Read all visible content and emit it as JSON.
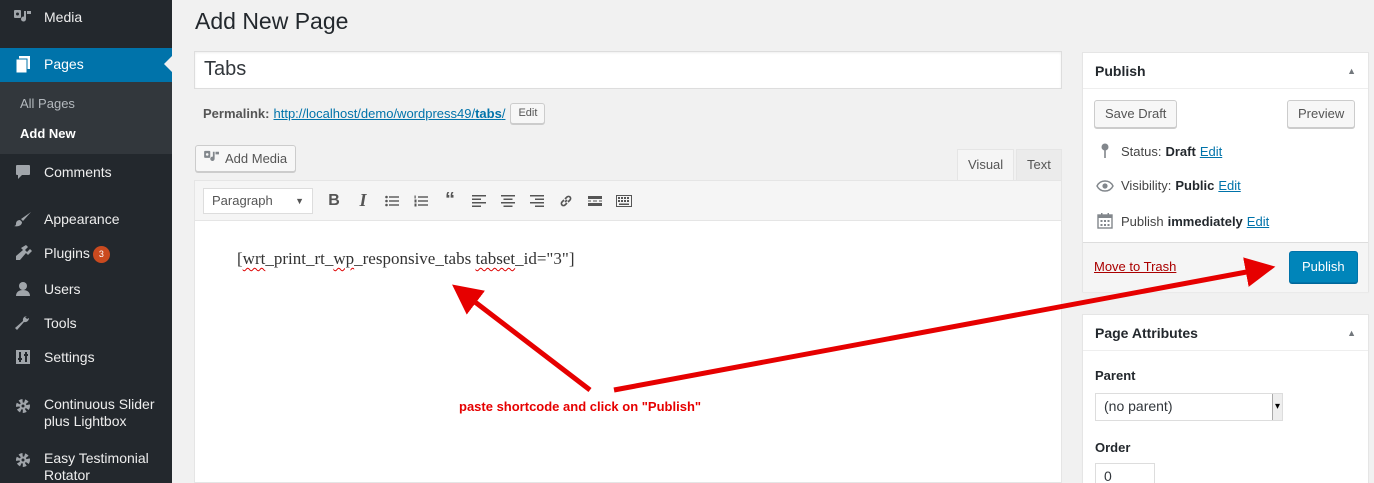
{
  "sidebar": {
    "items": [
      {
        "label": "Media",
        "icon": "media-icon"
      },
      {
        "label": "Pages",
        "icon": "pages-icon"
      },
      {
        "label": "Comments",
        "icon": "comments-icon"
      },
      {
        "label": "Appearance",
        "icon": "appearance-icon"
      },
      {
        "label": "Plugins",
        "icon": "plugins-icon",
        "badge": "3"
      },
      {
        "label": "Users",
        "icon": "users-icon"
      },
      {
        "label": "Tools",
        "icon": "tools-icon"
      },
      {
        "label": "Settings",
        "icon": "settings-icon"
      },
      {
        "label_line1": "Continuous Slider",
        "label_line2": "plus Lightbox",
        "icon": "gear-icon"
      },
      {
        "label_line1": "Easy Testimonial",
        "label_line2": "Rotator",
        "icon": "gear-icon"
      }
    ],
    "submenu": [
      "All Pages",
      "Add New"
    ]
  },
  "main": {
    "page_title": "Add New Page",
    "title_value": "Tabs",
    "permalink": {
      "label": "Permalink:",
      "url_base": "http://localhost/demo/wordpress49/",
      "slug": "tabs",
      "url_end": "/",
      "edit_label": "Edit"
    },
    "add_media_label": "Add Media",
    "tabs": {
      "visual": "Visual",
      "text": "Text"
    },
    "format_select": "Paragraph",
    "content": {
      "part1": "[",
      "word1": "wrt",
      "part2": "_print_rt_",
      "word2": "wp",
      "part3": "_responsive_tabs ",
      "word3": "tabset",
      "part4": "_id=\"3\"]"
    }
  },
  "publish_box": {
    "title": "Publish",
    "save_draft": "Save Draft",
    "preview": "Preview",
    "status_label": "Status:",
    "status_value": "Draft",
    "visibility_label": "Visibility:",
    "visibility_value": "Public",
    "publish_label": "Publish",
    "publish_value": "immediately",
    "edit_label": "Edit",
    "trash_label": "Move to Trash",
    "publish_button": "Publish"
  },
  "attributes_box": {
    "title": "Page Attributes",
    "parent_label": "Parent",
    "parent_value": "(no parent)",
    "order_label": "Order",
    "order_value": "0"
  },
  "annotation": {
    "text": "paste shortcode and click on \"Publish\"",
    "color": "#e60000"
  },
  "colors": {
    "sidebar_bg": "#23282d",
    "accent": "#0073aa",
    "publish_button": "#0085ba",
    "trash": "#aa0000"
  }
}
